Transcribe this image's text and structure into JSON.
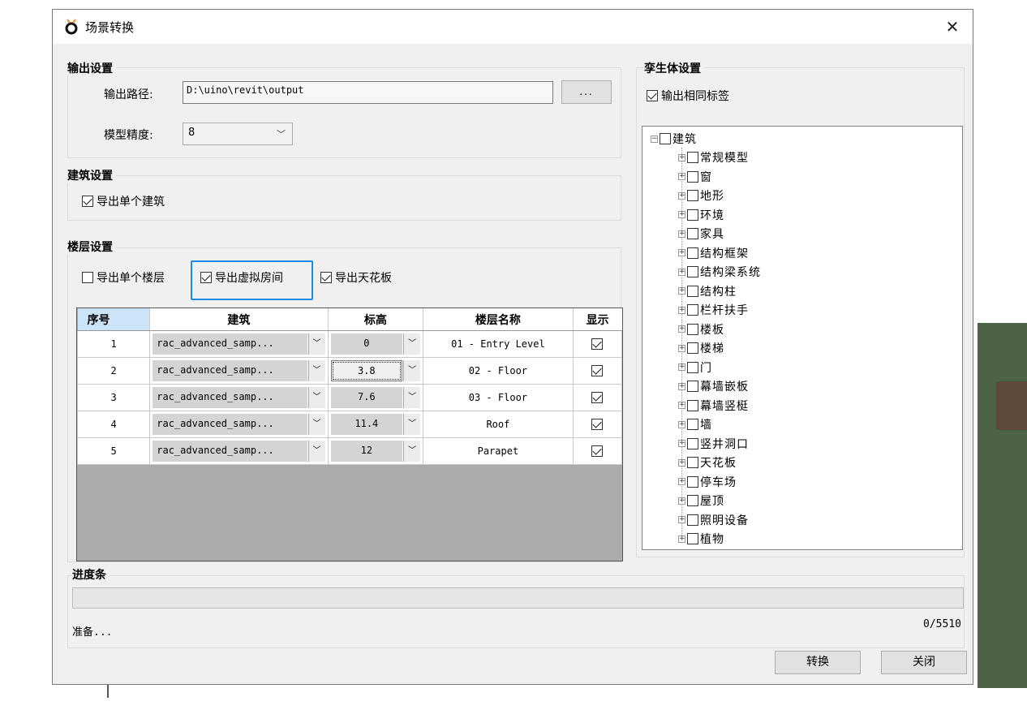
{
  "window": {
    "title": "场景转换",
    "close_glyph": "✕"
  },
  "output": {
    "legend": "输出设置",
    "path_label": "输出路径:",
    "path_value": "D:\\uino\\revit\\output",
    "browse_label": "...",
    "precision_label": "模型精度:",
    "precision_value": "8"
  },
  "building": {
    "legend": "建筑设置",
    "single_building": {
      "label": "导出单个建筑",
      "checked": true
    }
  },
  "floor": {
    "legend": "楼层设置",
    "single_floor": {
      "label": "导出单个楼层",
      "checked": false
    },
    "virtual_room": {
      "label": "导出虚拟房间",
      "checked": true
    },
    "ceiling": {
      "label": "导出天花板",
      "checked": true
    },
    "table": {
      "headers": [
        "序号",
        "建筑",
        "标高",
        "楼层名称",
        "显示"
      ],
      "rows": [
        {
          "index": "1",
          "building": "rac_advanced_samp...",
          "elevation": "0",
          "name": "01 - Entry Level",
          "show": true
        },
        {
          "index": "2",
          "building": "rac_advanced_samp...",
          "elevation": "3.8",
          "name": "02 - Floor",
          "show": true
        },
        {
          "index": "3",
          "building": "rac_advanced_samp...",
          "elevation": "7.6",
          "name": "03 - Floor",
          "show": true
        },
        {
          "index": "4",
          "building": "rac_advanced_samp...",
          "elevation": "11.4",
          "name": "Roof",
          "show": true
        },
        {
          "index": "5",
          "building": "rac_advanced_samp...",
          "elevation": "12",
          "name": "Parapet",
          "show": true
        }
      ]
    }
  },
  "twin": {
    "legend": "孪生体设置",
    "same_tag": {
      "label": "输出相同标签",
      "checked": true
    },
    "tree": {
      "root": "建筑",
      "children": [
        "常规模型",
        "窗",
        "地形",
        "环境",
        "家具",
        "结构框架",
        "结构梁系统",
        "结构柱",
        "栏杆扶手",
        "楼板",
        "楼梯",
        "门",
        "幕墙嵌板",
        "幕墙竖梃",
        "墙",
        "竖井洞口",
        "天花板",
        "停车场",
        "屋顶",
        "照明设备",
        "植物"
      ]
    }
  },
  "progress": {
    "legend": "进度条",
    "status": "准备...",
    "count": "0/5510",
    "fraction": 0
  },
  "footer": {
    "convert_label": "转换",
    "close_label": "关闭"
  }
}
